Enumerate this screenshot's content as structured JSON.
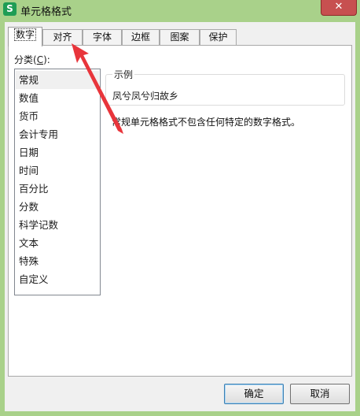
{
  "window": {
    "title": "单元格格式",
    "app_icon": "S",
    "close_glyph": "✕"
  },
  "tabs": [
    {
      "label": "数字",
      "active": true
    },
    {
      "label": "对齐",
      "active": false
    },
    {
      "label": "字体",
      "active": false
    },
    {
      "label": "边框",
      "active": false
    },
    {
      "label": "图案",
      "active": false
    },
    {
      "label": "保护",
      "active": false
    }
  ],
  "category": {
    "label_prefix": "分类(",
    "label_key": "C",
    "label_suffix": "):",
    "items": [
      "常规",
      "数值",
      "货币",
      "会计专用",
      "日期",
      "时间",
      "百分比",
      "分数",
      "科学记数",
      "文本",
      "特殊",
      "自定义"
    ],
    "selected": "常规"
  },
  "sample": {
    "legend": "示例",
    "value": "凤兮凤兮归故乡"
  },
  "description": "常规单元格格式不包含任何特定的数字格式。",
  "buttons": {
    "ok": "确定",
    "cancel": "取消"
  },
  "colors": {
    "title_bar": "#a9d18a",
    "close_button": "#c75050",
    "annotation_arrow": "#e8353b"
  }
}
